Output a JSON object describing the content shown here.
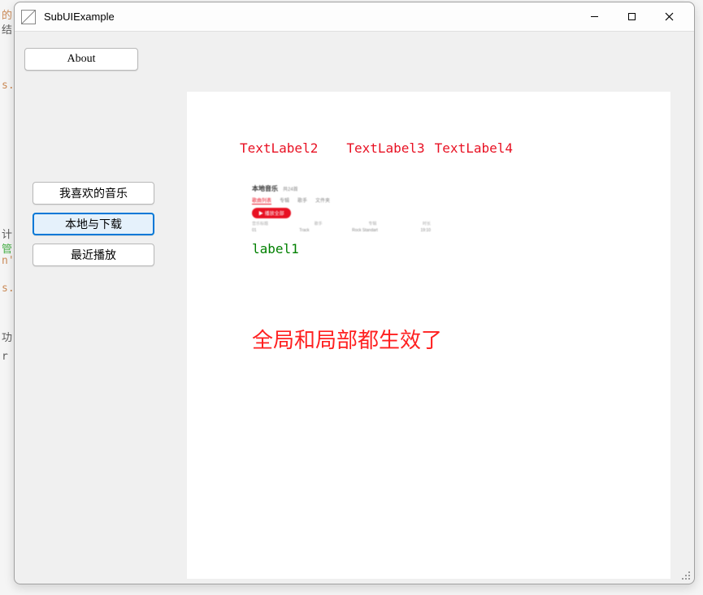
{
  "window": {
    "title": "SubUIExample"
  },
  "bg_fragments": {
    "t0": "的",
    "t1": "结",
    "t2": "s.",
    "t3": "计",
    "t4": "管",
    "t5": "n'",
    "t6": "s.",
    "t7": "功",
    "t8": "r"
  },
  "buttons": {
    "about": "About",
    "nav1": "我喜欢的音乐",
    "nav2": "本地与下载",
    "nav3": "最近播放"
  },
  "labels": {
    "l2": "TextLabel2",
    "l3": "TextLabel3",
    "l4": "TextLabel4",
    "label1": "label1",
    "big_msg": "全局和局部都生效了"
  },
  "mini": {
    "title": "本地音乐",
    "subtitle": "共24首",
    "tab1": "歌曲列表",
    "tab2": "专辑",
    "tab3": "歌手",
    "tab4": "文件夹",
    "play": "▶ 播放全部",
    "col1": "音乐标题",
    "col2": "歌手",
    "col3": "专辑",
    "col4": "时长",
    "row1a": "01",
    "row1b": "Track",
    "row1c": "Rock Standart",
    "row1d": "19:10"
  }
}
